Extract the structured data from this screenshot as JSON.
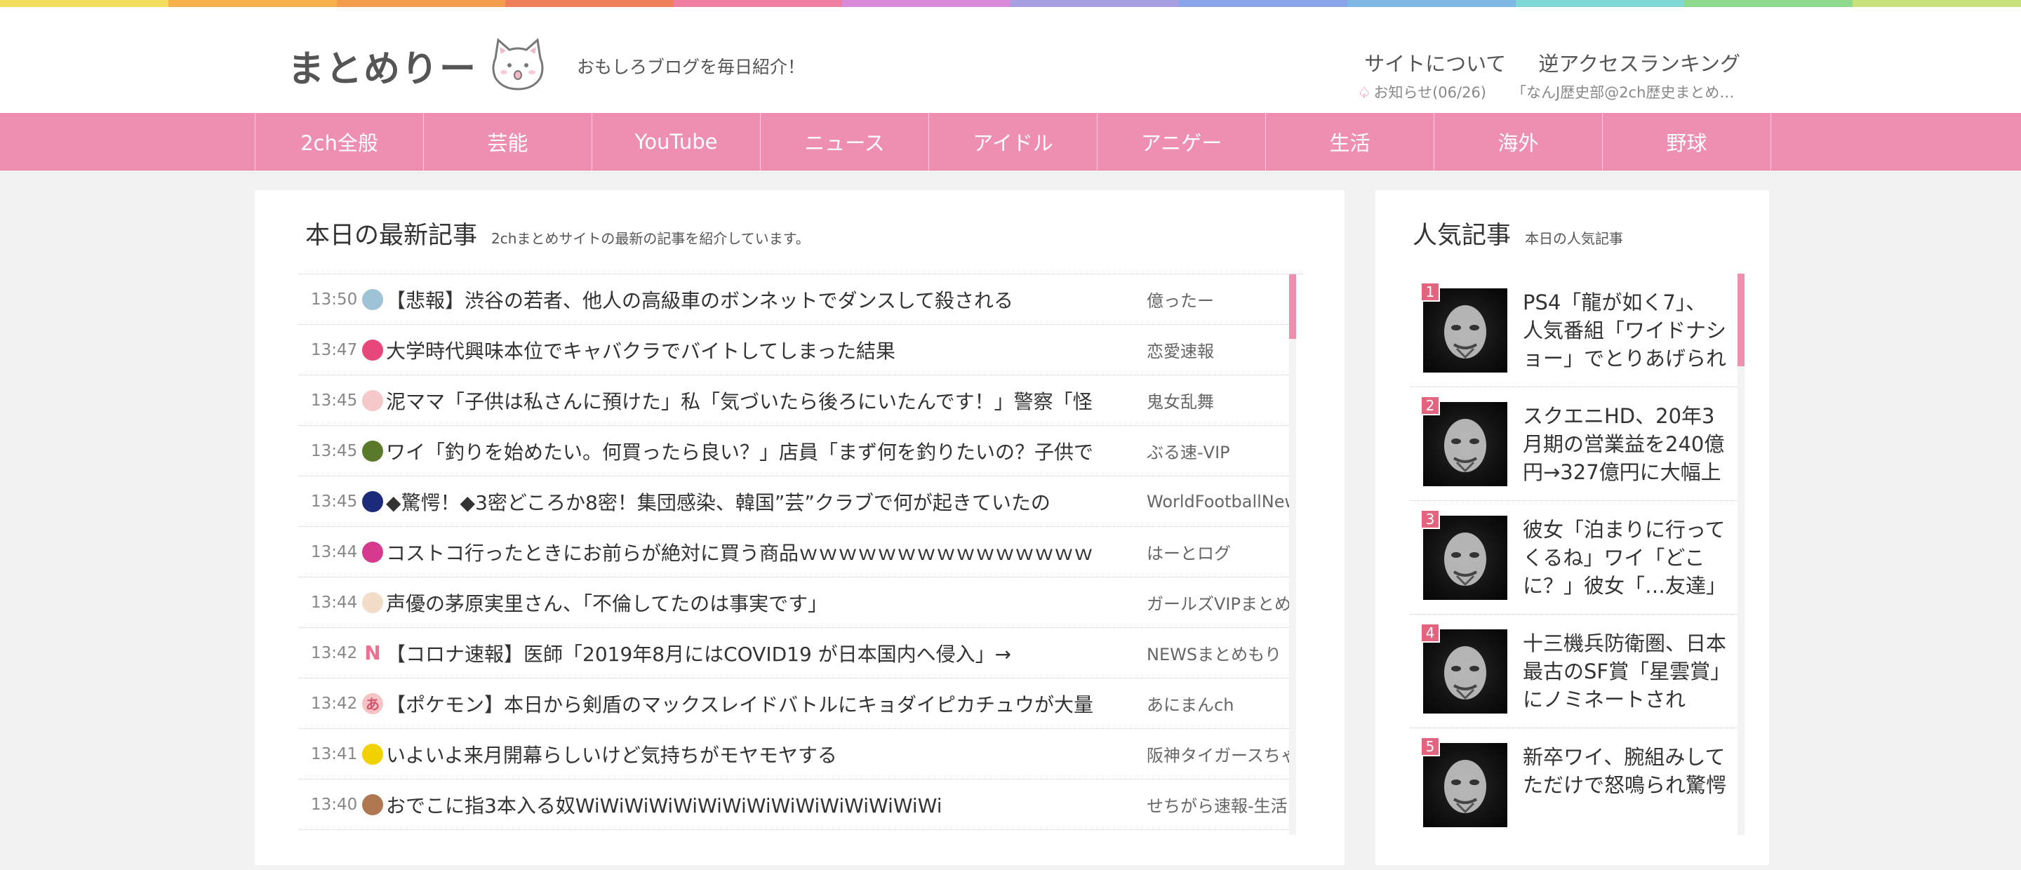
{
  "colors": {
    "accent_pink": "#ee8fb2",
    "rank_badge": "#e2647f",
    "rainbow": [
      "#f2de5c",
      "#f6b24a",
      "#f39c4b",
      "#ef7f5a",
      "#ee7fa1",
      "#d98bd9",
      "#a89fe2",
      "#8aa4e8",
      "#7fb9e3",
      "#7fd7d6",
      "#8fd98f",
      "#c9e27c"
    ]
  },
  "header": {
    "logo_text": "まとめりー",
    "tagline": "おもしろブログを毎日紹介！",
    "links": [
      "サイトについて",
      "逆アクセスランキング"
    ],
    "notice_label": "お知らせ(06/26)",
    "notice_text": "「なんJ歴史部@2ch歴史まとめブ…"
  },
  "nav": {
    "items": [
      "2ch全般",
      "芸能",
      "YouTube",
      "ニュース",
      "アイドル",
      "アニゲー",
      "生活",
      "海外",
      "野球"
    ]
  },
  "latest": {
    "title": "本日の最新記事",
    "subtitle": "2chまとめサイトの最新の記事を紹介しています。",
    "rows": [
      {
        "time": "13:50",
        "title": "【悲報】渋谷の若者、他人の高級車のボンネットでダンスして殺される",
        "source": "億ったー",
        "icon": "#9ec3d6",
        "glyph": ""
      },
      {
        "time": "13:47",
        "title": "大学時代興味本位でキャバクラでバイトしてしまった結果",
        "source": "恋愛速報",
        "icon": "#e8477a",
        "glyph": ""
      },
      {
        "time": "13:45",
        "title": "泥ママ「子供は私さんに預けた」私「気づいたら後ろにいたんです！」警察「怪",
        "source": "鬼女乱舞",
        "icon": "#f5c9c9",
        "glyph": ""
      },
      {
        "time": "13:45",
        "title": "ワイ「釣りを始めたい。何買ったら良い？」店員「まず何を釣りたいの？子供で",
        "source": "ぶる速-VIP",
        "icon": "#5a7a2a",
        "glyph": ""
      },
      {
        "time": "13:45",
        "title": "◆驚愕！◆3密どころか8密！集団感染、韓国”芸”クラブで何が起きていたの",
        "source": "WorldFootballNews",
        "icon": "#1c2a7a",
        "glyph": ""
      },
      {
        "time": "13:44",
        "title": "コストコ行ったときにお前らが絶対に買う商品ｗｗｗｗｗｗｗｗｗｗｗｗｗｗｗ",
        "source": "はーとログ",
        "icon": "#d63a8e",
        "glyph": ""
      },
      {
        "time": "13:44",
        "title": "声優の茅原実里さん、「不倫してたのは事実です」",
        "source": "ガールズVIPまとめ",
        "icon": "#f3dcc8",
        "glyph": ""
      },
      {
        "time": "13:42",
        "title": "【コロナ速報】医師「2019年8月にはCOVID19 が日本国内へ侵入」→",
        "source": "NEWSまとめもり",
        "icon": "#ffffff",
        "glyph": "N"
      },
      {
        "time": "13:42",
        "title": "【ポケモン】本日から剣盾のマックスレイドバトルにキョダイピカチュウが大量",
        "source": "あにまんch",
        "icon": "#f6c4c4",
        "glyph": "あ"
      },
      {
        "time": "13:41",
        "title": "いよいよ来月開幕らしいけど気持ちがモヤモヤする",
        "source": "阪神タイガースちゃんねる",
        "icon": "#f2d100",
        "glyph": ""
      },
      {
        "time": "13:40",
        "title": "おでこに指3本入る奴WiWiWiWiWiWiWiWiWiWiWiWiWiWiWi",
        "source": "せちがら速報-生活",
        "icon": "#b07850",
        "glyph": ""
      }
    ]
  },
  "popular": {
    "title": "人気記事",
    "subtitle": "本日の人気記事",
    "items": [
      {
        "rank": "1",
        "title": "PS4「龍が如く7」、人気番組「ワイドナショー」でとりあげられ"
      },
      {
        "rank": "2",
        "title": "スクエニHD、20年3月期の営業益を240億円→327億円に大幅上"
      },
      {
        "rank": "3",
        "title": "彼女「泊まりに行ってくるね」ワイ「どこに？」彼女「…友達」"
      },
      {
        "rank": "4",
        "title": "十三機兵防衛圏、日本最古のSF賞「星雲賞」にノミネートされ"
      },
      {
        "rank": "5",
        "title": "新卒ワイ、腕組みしてただけで怒鳴られ驚愕"
      }
    ]
  }
}
